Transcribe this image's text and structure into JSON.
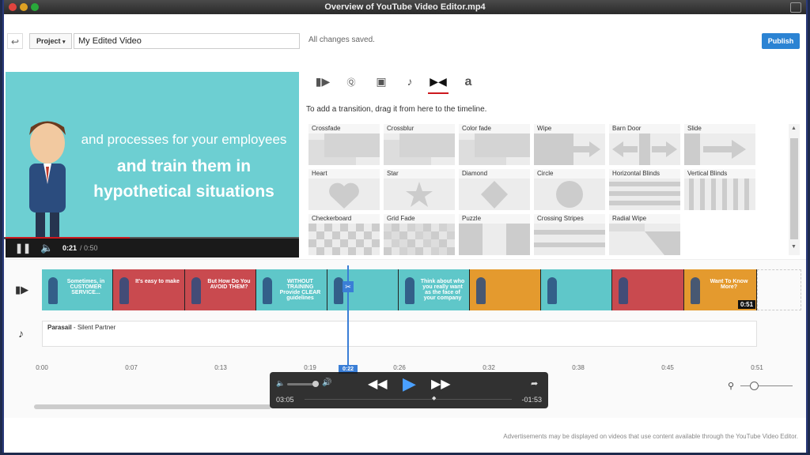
{
  "window": {
    "title": "Overview of YouTube Video Editor.mp4"
  },
  "topbar": {
    "project_label": "Project",
    "project_name": "My Edited Video",
    "status": "All changes saved.",
    "publish_label": "Publish"
  },
  "video": {
    "line1": "and processes for your employees",
    "line2": "and train them in",
    "line3": "hypothetical situations",
    "time_current": "0:21",
    "time_total": "/ 0:50",
    "progress_fraction": 0.42
  },
  "tabs": [
    {
      "icon": "video-camera-icon"
    },
    {
      "icon": "cc-icon"
    },
    {
      "icon": "camera-icon"
    },
    {
      "icon": "music-note-icon"
    },
    {
      "icon": "bowtie-icon"
    },
    {
      "icon": "text-icon"
    }
  ],
  "transitions": {
    "hint": "To add a transition, drag it from here to the timeline.",
    "items": [
      "Crossfade",
      "Crossblur",
      "Color fade",
      "Wipe",
      "Barn Door",
      "Slide",
      "Heart",
      "Star",
      "Diamond",
      "Circle",
      "Horizontal Blinds",
      "Vertical Blinds",
      "Checkerboard",
      "Grid Fade",
      "Puzzle",
      "Crossing Stripes",
      "Radial Wipe"
    ]
  },
  "timeline": {
    "clips": [
      {
        "text": "Sometimes, in CUSTOMER SERVICE...",
        "color": "#5fc7c9"
      },
      {
        "text": "It's easy to make",
        "color": "#c94a4f"
      },
      {
        "text": "But How Do You AVOID THEM?",
        "color": "#c94a4f"
      },
      {
        "text": "WITHOUT TRAINING Provide CLEAR guidelines",
        "color": "#5fc7c9"
      },
      {
        "text": "",
        "color": "#5fc7c9"
      },
      {
        "text": "Think about who you really want as the face of your company",
        "color": "#5fc7c9"
      },
      {
        "text": "",
        "color": "#e49a2e"
      },
      {
        "text": "",
        "color": "#5fc7c9"
      },
      {
        "text": "",
        "color": "#c94a4f"
      },
      {
        "text": "Want To Know More?",
        "color": "#e49a2e"
      }
    ],
    "clip_duration": "0:51",
    "audio_title": "Parasail",
    "audio_sep": " - ",
    "audio_artist": "Silent Partner",
    "ticks": [
      "0:00",
      "0:07",
      "0:13",
      "0:19",
      "0:26",
      "0:32",
      "0:38",
      "0:45",
      "0:51"
    ],
    "playhead": "0:22"
  },
  "player": {
    "elapsed": "03:05",
    "remaining": "-01:53"
  },
  "footer": "Advertisements may be displayed on videos that use content available through the YouTube Video Editor."
}
